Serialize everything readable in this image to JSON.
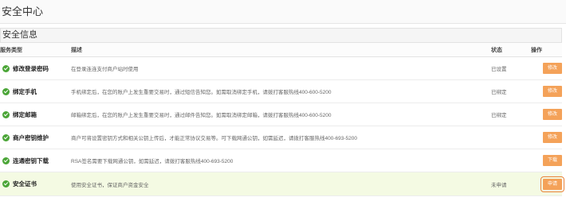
{
  "page": {
    "title": "安全中心"
  },
  "panel": {
    "title": "安全信息"
  },
  "table": {
    "headers": {
      "type": "服务类型",
      "desc": "描述",
      "status": "状态",
      "op": "操作"
    },
    "rows": [
      {
        "type": "修改登录密码",
        "desc": "在登录连连支付商户站时使用",
        "status": "已设置",
        "action": "修改"
      },
      {
        "type": "绑定手机",
        "desc": "手机绑定后，在您的账户上发生重要交易时，通过短信告知您。如需取消绑定手机，请拨打客服热线400-600-5200",
        "status": "已绑定",
        "action": "修改"
      },
      {
        "type": "绑定邮箱",
        "desc": "邮箱绑定后，在您的账户上发生重要交易时，通过邮件告知您。如需取消绑定邮箱，请拨打客服热线400-600-5200",
        "status": "已绑定",
        "action": "修改"
      },
      {
        "type": "商户密钥维护",
        "desc": "商户可将设置密钥方式和相关公钥上传后，才能正常协议交易等。可下载网通公钥，如需延迟，请拨打客服热线400-693-5200",
        "status": "",
        "action": "修改"
      },
      {
        "type": "连通密钥下载",
        "desc": "RSA签名需要下载网通公钥，如需延迟，请拨打客服热线400-693-5200",
        "status": "",
        "action": "下载"
      },
      {
        "type": "安全证书",
        "desc": "使用安全证书，保证商户资金安全",
        "status": "未申请",
        "action": "申请"
      }
    ]
  },
  "colors": {
    "accent_button": "#f4a259",
    "check_icon": "#4aa536",
    "highlight_row": "#f4fae3"
  },
  "icons": {
    "row_status": "check-circle-icon"
  }
}
